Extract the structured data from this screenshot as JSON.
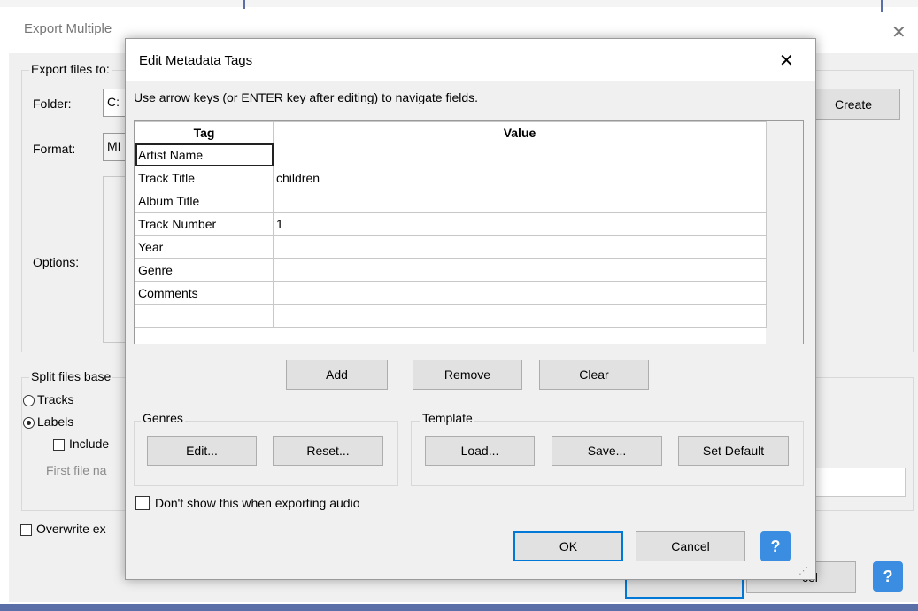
{
  "background_window": {
    "title": "Export Multiple",
    "close_glyph": "✕",
    "export_group_label": "Export files to:",
    "folder_label": "Folder:",
    "folder_value": "C:",
    "create_button": "Create",
    "format_label": "Format:",
    "format_value": "MI",
    "options_label": "Options:",
    "split_group_label": "Split files base",
    "tracks_label": "Tracks",
    "labels_label": "Labels",
    "include_label": "Include",
    "first_file_label": "First file na",
    "overwrite_label": "Overwrite ex",
    "cancel_partial": "cel",
    "help_glyph": "?"
  },
  "dialog": {
    "title": "Edit Metadata Tags",
    "close_glyph": "✕",
    "instruction": "Use arrow keys (or ENTER key after editing) to navigate fields.",
    "table": {
      "headers": [
        "Tag",
        "Value"
      ],
      "rows": [
        {
          "tag": "Artist Name",
          "value": ""
        },
        {
          "tag": "Track Title",
          "value": "children"
        },
        {
          "tag": "Album Title",
          "value": ""
        },
        {
          "tag": "Track Number",
          "value": "1"
        },
        {
          "tag": "Year",
          "value": ""
        },
        {
          "tag": "Genre",
          "value": ""
        },
        {
          "tag": "Comments",
          "value": ""
        },
        {
          "tag": "",
          "value": ""
        }
      ]
    },
    "add_button": "Add",
    "remove_button": "Remove",
    "clear_button": "Clear",
    "genres_group": "Genres",
    "genres_edit": "Edit...",
    "genres_reset": "Reset...",
    "template_group": "Template",
    "template_load": "Load...",
    "template_save": "Save...",
    "template_default": "Set Default",
    "dont_show_label": "Don't show this when exporting audio",
    "ok_button": "OK",
    "cancel_button": "Cancel",
    "help_glyph": "?"
  }
}
